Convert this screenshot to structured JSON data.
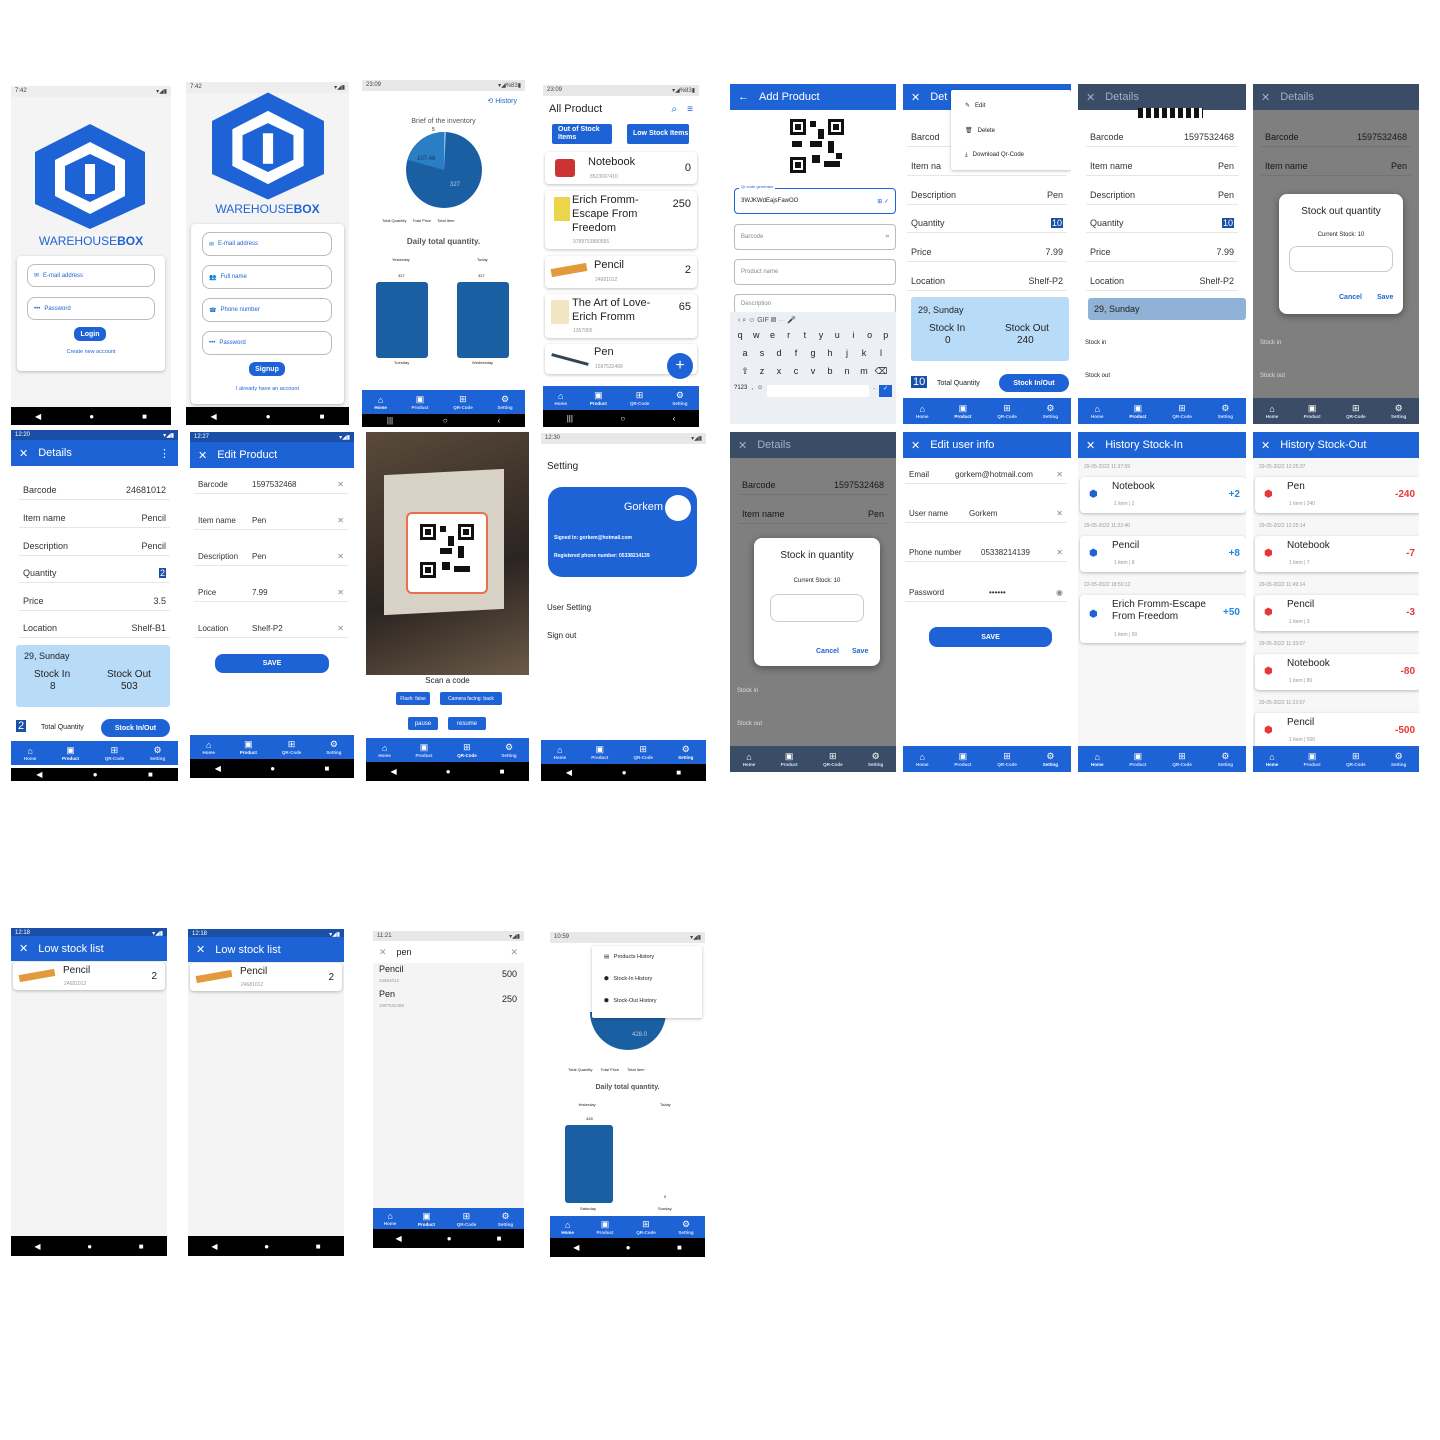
{
  "login": {
    "time": "7:42",
    "brand_a": "WAREHOUSE",
    "brand_b": "BOX",
    "email": "E-mail address",
    "password": "Password",
    "login": "Login",
    "create": "Create new account"
  },
  "signup": {
    "time": "7:42",
    "brand_a": "WAREHOUSE",
    "brand_b": "BOX",
    "email": "E-mail address",
    "fullname": "Full name",
    "phone": "Phone number",
    "password": "Password",
    "signup": "Signup",
    "already": "I already have an account"
  },
  "home": {
    "time": "23:09",
    "history": "History",
    "brief": "Brief of the inventory",
    "pie_a": "107.48",
    "pie_b": "327",
    "pie_top": "5",
    "legend": [
      "Total Quantity",
      "Total Price",
      "Total Item"
    ],
    "daily": "Daily total quantity.",
    "yesterday": "Yesterday",
    "today": "Today",
    "bar_a": "327",
    "bar_b": "327",
    "day_a": "Tuesday",
    "day_b": "Wednesday"
  },
  "allproduct": {
    "time": "23:09",
    "title": "All Product",
    "tab_a": "Out of Stock Items",
    "tab_b": "Low Stock Items",
    "items": [
      {
        "name": "Notebook",
        "code": "8523697410",
        "qty": "0"
      },
      {
        "name": "Erich Fromm-Escape From Freedom",
        "code": "9789753880565",
        "qty": "250"
      },
      {
        "name": "Pencil",
        "code": "24681012",
        "qty": "2"
      },
      {
        "name": "The Art of Love-Erich Fromm",
        "code": "1357955",
        "qty": "65"
      },
      {
        "name": "Pen",
        "code": "1597532468",
        "qty": ""
      }
    ]
  },
  "addproduct": {
    "title": "Add Product",
    "qr_label": "Qr code generator",
    "qr_val": "3WJKWdEajsFawOO",
    "barcode": "Barcode",
    "productname": "Product name",
    "description": "Description",
    "row1": [
      "q",
      "w",
      "e",
      "r",
      "t",
      "y",
      "u",
      "i",
      "o",
      "p"
    ],
    "row2": [
      "a",
      "s",
      "d",
      "f",
      "g",
      "h",
      "j",
      "k",
      "l"
    ],
    "row3": [
      "z",
      "x",
      "c",
      "v",
      "b",
      "n",
      "m"
    ],
    "key123": "?123"
  },
  "details_menu": {
    "title": "Det",
    "barcode": "Barcod",
    "itemname": "Item na",
    "menu": [
      "Edit",
      "Delete",
      "Download Qr-Code"
    ],
    "description": "Description",
    "desc_val": "Pen",
    "quantity": "Quantity",
    "qty_val": "10",
    "price": "Price",
    "price_val": "7.99",
    "location": "Location",
    "loc_val": "Shelf-P2",
    "date": "29, Sunday",
    "stockin": "Stock In",
    "in_val": "0",
    "stockout": "Stock Out",
    "out_val": "240",
    "total": "Total Quantity",
    "total_val": "10",
    "btn": "Stock In/Out"
  },
  "details_pen": {
    "title": "Details",
    "barcode": "Barcode",
    "bc_val": "1597532468",
    "itemname": "Item name",
    "in_val": "Pen",
    "description": "Description",
    "desc_val": "Pen",
    "quantity": "Quantity",
    "qty_val": "10",
    "price": "Price",
    "price_val": "7.99",
    "location": "Location",
    "loc_val": "Shelf-P2",
    "date": "29, Sunday",
    "stockin": "Stock in",
    "stockout": "Stock out"
  },
  "stockout_dlg": {
    "title": "Stock out quantity",
    "current": "Current Stock: 10",
    "cancel": "Cancel",
    "save": "Save"
  },
  "details_pencil": {
    "time": "12:20",
    "title": "Details",
    "barcode": "Barcode",
    "bc_val": "24681012",
    "itemname": "Item name",
    "in_val": "Pencil",
    "description": "Description",
    "desc_val": "Pencil",
    "quantity": "Quantity",
    "qty_val": "2",
    "price": "Price",
    "price_val": "3.5",
    "location": "Location",
    "loc_val": "Shelf-B1",
    "date": "29, Sunday",
    "stockin": "Stock In",
    "in_val2": "8",
    "stockout": "Stock Out",
    "out_val": "503",
    "total": "Total Quantity",
    "total_val": "2",
    "btn": "Stock In/Out"
  },
  "editproduct": {
    "time": "12:27",
    "title": "Edit Product",
    "fields": [
      {
        "label": "Barcode",
        "value": "1597532468"
      },
      {
        "label": "Item name",
        "value": "Pen"
      },
      {
        "label": "Description",
        "value": "Pen"
      },
      {
        "label": "Price",
        "value": "7.99"
      },
      {
        "label": "Location",
        "value": "Shelf-P2"
      }
    ],
    "save": "SAVE"
  },
  "scan": {
    "label": "Scan a code",
    "flash": "Flash: false",
    "camera": "Camera facing: back",
    "pause": "pause",
    "resume": "resume"
  },
  "setting": {
    "time": "12:30",
    "title": "Setting",
    "user": "Gorkem",
    "signed": "Signed in: gorkem@hotmail.com",
    "phone": "Registered phone number: 05338214139",
    "usersetting": "User Setting",
    "signout": "Sign out"
  },
  "stockin_dlg": {
    "bc_val": "1597532468",
    "barcode": "Barcode",
    "itemname": "Item name",
    "in_val": "Pen",
    "title": "Stock in quantity",
    "current": "Current Stock: 10",
    "cancel": "Cancel",
    "save": "Save",
    "stockin": "Stock in",
    "stockout": "Stock out",
    "details": "Details"
  },
  "edituser": {
    "title": "Edit user info",
    "email": "Email",
    "email_val": "gorkem@hotmail.com",
    "username": "User name",
    "user_val": "Gorkem",
    "phone": "Phone number",
    "phone_val": "05338214139",
    "password": "Password",
    "pw_val": "••••••",
    "save": "SAVE"
  },
  "histin": {
    "title": "History Stock-In",
    "items": [
      {
        "date": "29-05-2022 11:37:59",
        "name": "Notebook",
        "sub": "1 item | 2",
        "delta": "+2"
      },
      {
        "date": "29-05-2022 11:22:40",
        "name": "Pencil",
        "sub": "1 item | 8",
        "delta": "+8"
      },
      {
        "date": "22-05-2022 18:50:12",
        "name": "Erich Fromm-Escape From Freedom",
        "sub": "1 item | 50",
        "delta": "+50"
      }
    ]
  },
  "histout": {
    "title": "History Stock-Out",
    "items": [
      {
        "date": "29-05-2022 12:25:37",
        "name": "Pen",
        "sub": "1 item | 240",
        "delta": "-240"
      },
      {
        "date": "29-05-2022 12:25:14",
        "name": "Notebook",
        "sub": "1 item | 7",
        "delta": "-7"
      },
      {
        "date": "29-05-2022 11:49:14",
        "name": "Pencil",
        "sub": "1 item | 3",
        "delta": "-3"
      },
      {
        "date": "29-05-2022 11:33:07",
        "name": "Notebook",
        "sub": "1 item | 80",
        "delta": "-80"
      },
      {
        "date": "29-05-2022 11:22:07",
        "name": "Pencil",
        "sub": "1 item | 500",
        "delta": "-500"
      }
    ]
  },
  "lowstock": {
    "time": "12:18",
    "title": "Low stock list",
    "item": "Pencil",
    "code": "24681012",
    "qty": "2"
  },
  "search": {
    "time": "11:21",
    "query": "pen",
    "items": [
      {
        "name": "Pencil",
        "code": "24681012",
        "qty": "500"
      },
      {
        "name": "Pen",
        "code": "1597532468",
        "qty": "250"
      }
    ]
  },
  "home2": {
    "time": "10:59",
    "menu": [
      "Products History",
      "Stock-In History",
      "Stock-Out History"
    ],
    "pie_val": "428.0",
    "legend": [
      "Total Quantity",
      "Total Price",
      "Total Item"
    ],
    "daily": "Daily total quantity.",
    "yesterday": "Yesterday",
    "today": "Today",
    "bar_a": "428",
    "bar_b": "0",
    "day_a": "Saturday",
    "day_b": "Sunday"
  },
  "nav": {
    "home": "Home",
    "product": "Product",
    "qr": "QR-Code",
    "setting": "Setting"
  }
}
